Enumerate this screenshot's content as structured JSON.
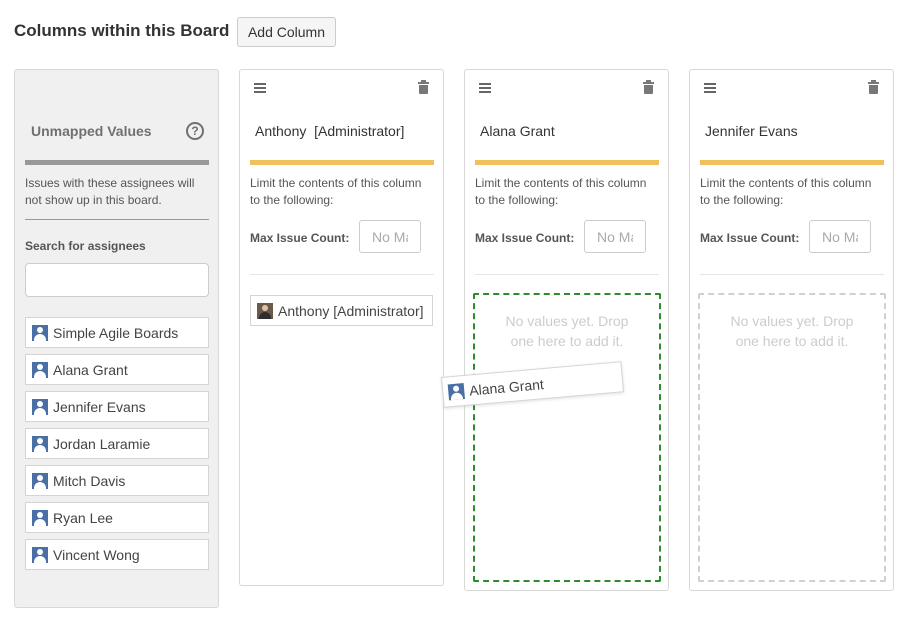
{
  "header": {
    "title": "Columns within this Board",
    "add_column_label": "Add Column"
  },
  "unmapped": {
    "title": "Unmapped Values",
    "help_glyph": "?",
    "description": "Issues with these assignees will not show up in this board.",
    "search_label": "Search for assignees",
    "search_value": "",
    "items": [
      {
        "label": "Simple Agile Boards"
      },
      {
        "label": "Alana Grant"
      },
      {
        "label": "Jennifer Evans"
      },
      {
        "label": "Jordan Laramie"
      },
      {
        "label": "Mitch Davis"
      },
      {
        "label": "Ryan Lee"
      },
      {
        "label": "Vincent Wong"
      }
    ]
  },
  "columns": [
    {
      "name": "Anthony  [Administrator]",
      "limit_desc": "Limit the contents of this column to the following:",
      "max_label": "Max Issue Count:",
      "max_placeholder": "No Max",
      "mapped": [
        {
          "label": "Anthony [Administrator]"
        }
      ]
    },
    {
      "name": "Alana Grant",
      "limit_desc": "Limit the contents of this column to the following:",
      "max_label": "Max Issue Count:",
      "max_placeholder": "No Max",
      "empty_text": "No values yet. Drop one here to add it."
    },
    {
      "name": "Jennifer Evans",
      "limit_desc": "Limit the contents of this column to the following:",
      "max_label": "Max Issue Count:",
      "max_placeholder": "No Max",
      "empty_text": "No values yet. Drop one here to add it."
    }
  ],
  "dragging_item": {
    "label": "Alana Grant"
  },
  "colors": {
    "column_bar": "#f0c05a",
    "unmapped_bar": "#999999",
    "active_drop_border": "#2e8b2e",
    "avatar": "#4a6fa5"
  }
}
